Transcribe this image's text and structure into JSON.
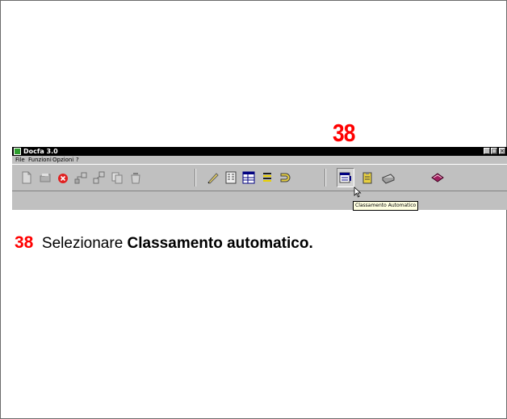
{
  "step_number": "38",
  "window": {
    "title": "Docfa 3.0",
    "controls": {
      "minimize": "_",
      "maximize": "□",
      "close": "×"
    }
  },
  "menu": {
    "items": [
      "File",
      "Funzioni",
      "Opzioni",
      "?"
    ]
  },
  "toolbar": {
    "icons": [
      "new-document-icon",
      "open-folder-icon",
      "stop-icon",
      "network-icon-1",
      "network-icon-2",
      "copy-icon",
      "recycle-icon",
      "pencil-icon",
      "form-icon",
      "data-grid-icon",
      "stack-icon",
      "magnet-icon",
      "classamento-automatico-icon",
      "clipboard-icon",
      "printer-icon",
      "book-icon"
    ],
    "tooltip": "Classamento Automatico"
  },
  "instruction": {
    "number": "38",
    "text": "Selezionare",
    "bold_text": "Classamento automatico."
  },
  "colors": {
    "step_red": "#ff0000",
    "titlebar": "#000000",
    "window_face": "#c0c0c0",
    "tooltip_bg": "#ffffe1"
  }
}
